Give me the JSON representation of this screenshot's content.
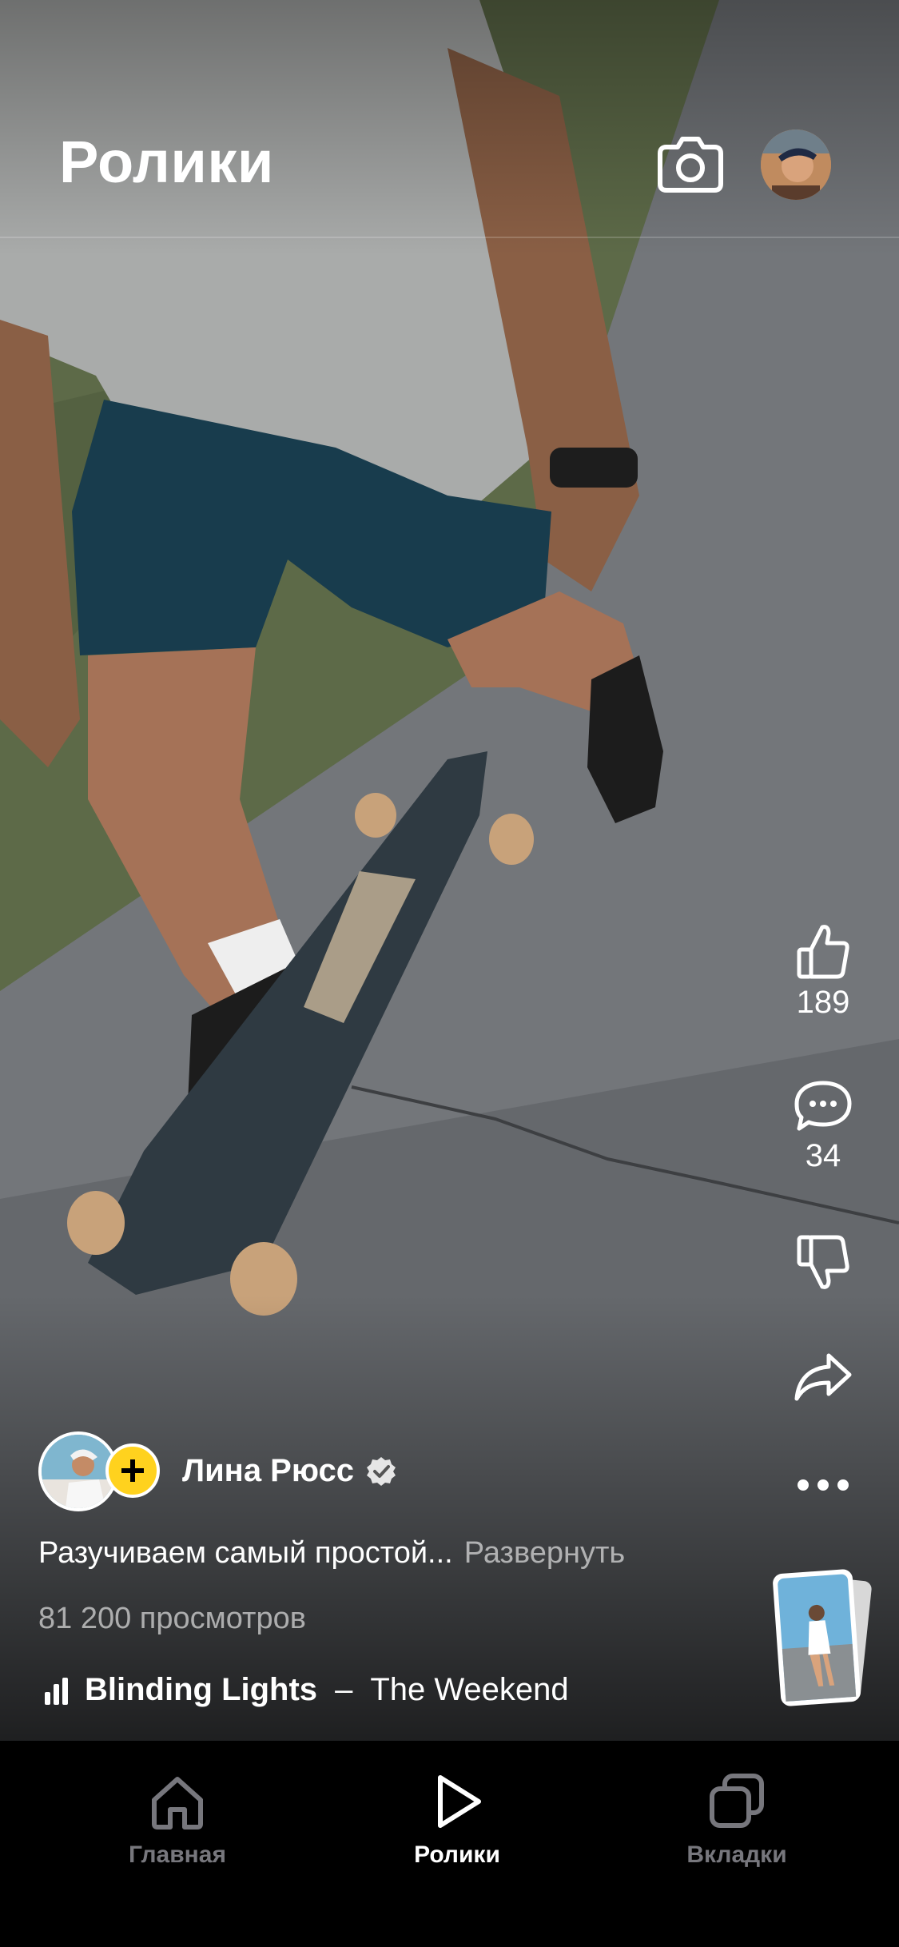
{
  "header": {
    "title": "Ролики"
  },
  "actions": {
    "likes_count": "189",
    "comments_count": "34"
  },
  "author": {
    "name": "Лина Рюсс"
  },
  "video": {
    "description": "Разучиваем самый простой...",
    "expand_label": "Развернуть",
    "views": "81 200 просмотров"
  },
  "music": {
    "song": "Blinding Lights",
    "separator": "–",
    "artist": "The Weekend"
  },
  "tabbar": {
    "items": [
      {
        "label": "Главная",
        "icon": "home-icon",
        "active": false
      },
      {
        "label": "Ролики",
        "icon": "play-icon",
        "active": true
      },
      {
        "label": "Вкладки",
        "icon": "tabs-icon",
        "active": false
      }
    ]
  },
  "colors": {
    "follow_accent": "#ffd21e",
    "inactive_tab": "#77777d",
    "background": "#000000"
  }
}
